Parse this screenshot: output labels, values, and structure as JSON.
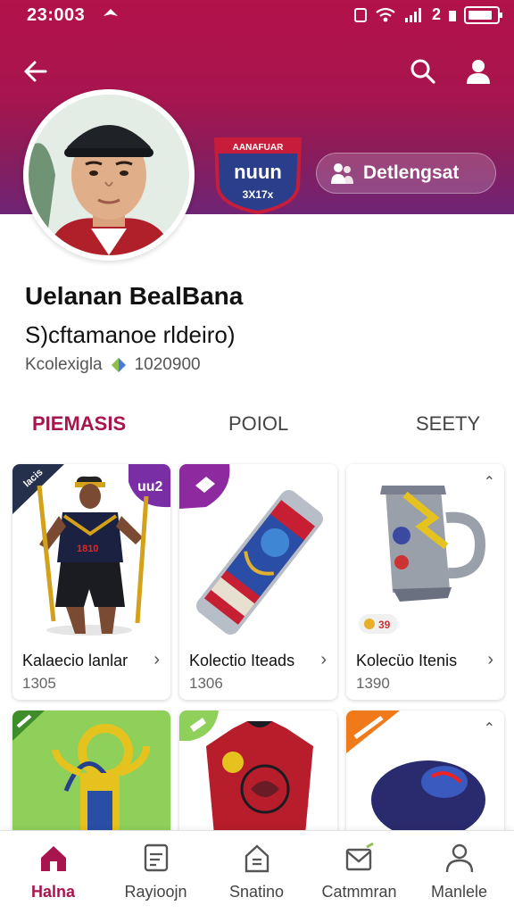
{
  "status": {
    "time": "23:003",
    "right_text": "2"
  },
  "profile": {
    "name": "Uelanan BealBana",
    "subtitle": "S)cftamanoe rldeiro)",
    "meta_label": "Kcolexigla",
    "meta_value": "1020900",
    "detail_button": "Detlengsat",
    "logo_top": "AANAFUAR",
    "logo_mid": "nuun",
    "logo_bottom": "3X17x"
  },
  "tabs": [
    {
      "label": "PIEMASIS",
      "active": true
    },
    {
      "label": "POIOL",
      "active": false
    },
    {
      "label": "SEETY",
      "active": false
    }
  ],
  "collection": [
    {
      "title": "Kalaecio lanlar",
      "count": "1305",
      "badge_text": "lacis",
      "badge2_text": "uu2"
    },
    {
      "title": "Kolectio Iteads",
      "count": "1306"
    },
    {
      "title": "Kolecüo Itenis",
      "count": "1390",
      "tag": "39"
    }
  ],
  "bottom_nav": [
    {
      "label": "Halna",
      "icon": "home-icon",
      "active": true
    },
    {
      "label": "Rayioojn",
      "icon": "clipboard-icon",
      "active": false
    },
    {
      "label": "Snatino",
      "icon": "house-outline-icon",
      "active": false
    },
    {
      "label": "Catmmran",
      "icon": "envelope-icon",
      "active": false
    },
    {
      "label": "Manlele",
      "icon": "person-icon",
      "active": false
    }
  ],
  "colors": {
    "brand": "#a8154e",
    "header_dark": "#6f2475",
    "accent_purple": "#8e2a9f",
    "green_bg": "#8ed05a",
    "orange": "#f07a1a"
  }
}
